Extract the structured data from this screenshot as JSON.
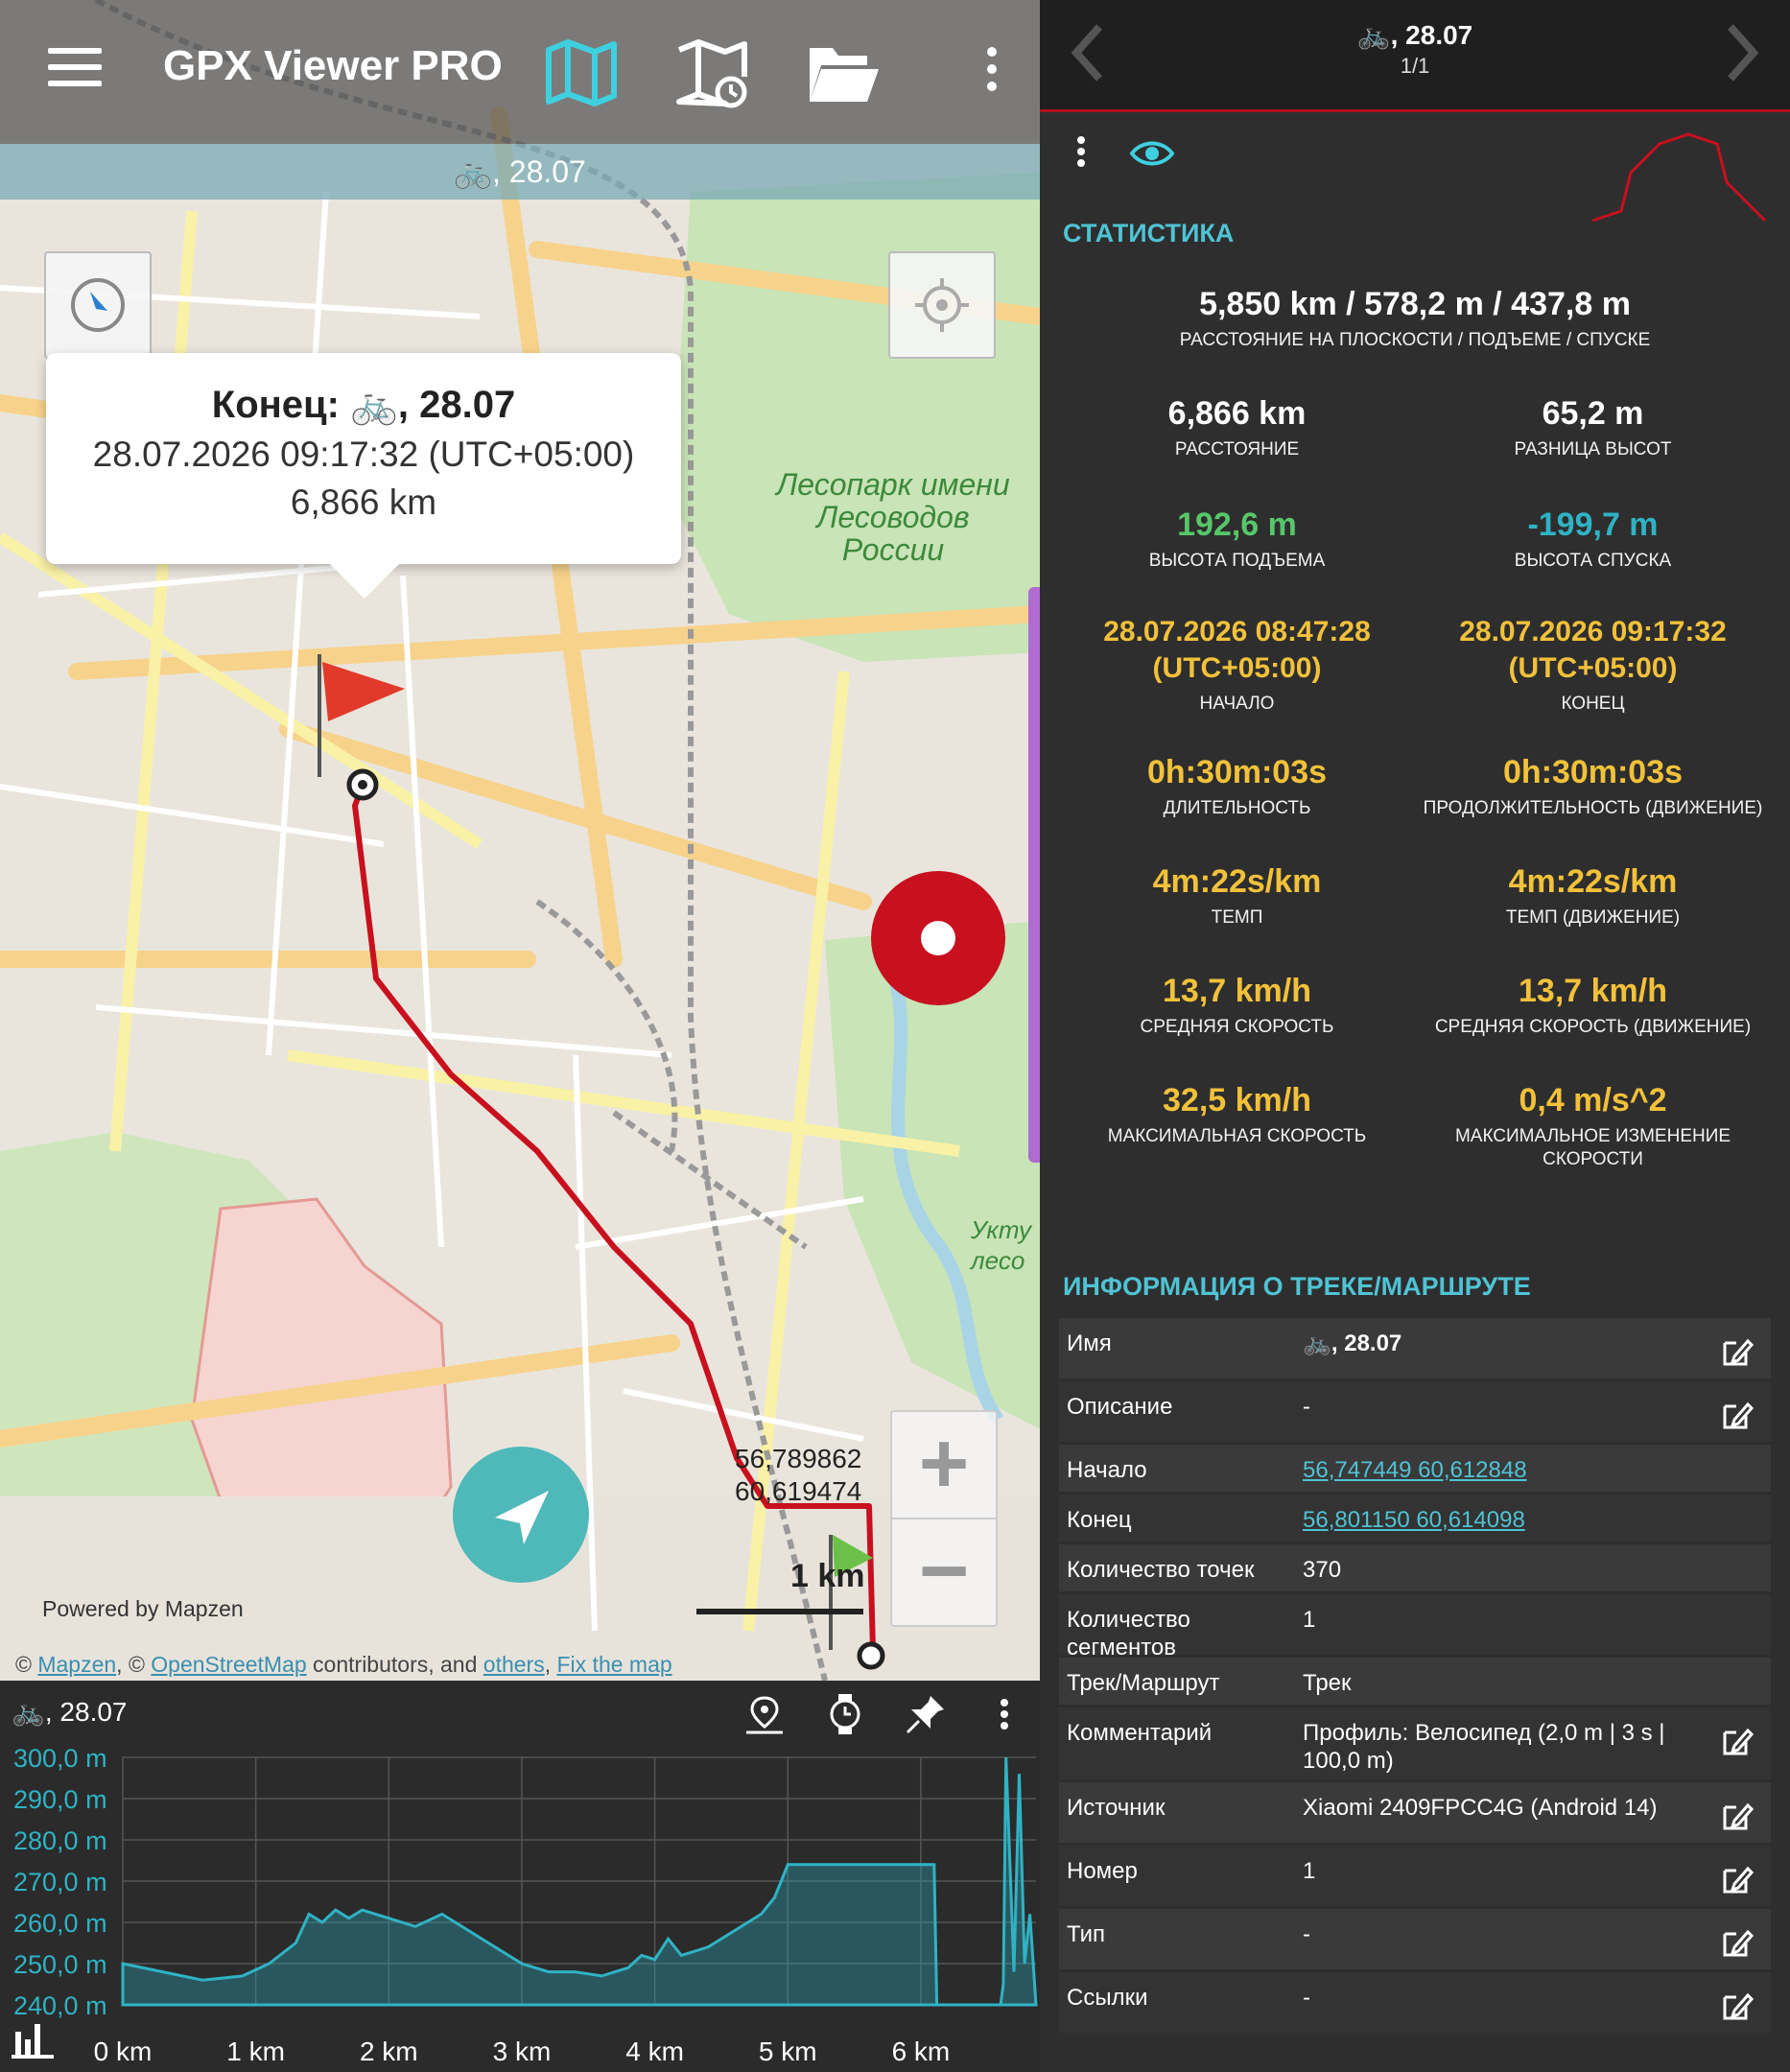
{
  "app": {
    "title": "GPX Viewer PRO",
    "track_label": "🚲, 28.07"
  },
  "map": {
    "popup": {
      "title": "Конец: 🚲, 28.07",
      "time": "28.07.2026 09:17:32 (UTC+05:00)",
      "distance": "6,866 km"
    },
    "park_label": [
      "Лесопарк имени",
      "Лесоводов",
      "России"
    ],
    "park_label2": [
      "Укту",
      "лесо"
    ],
    "coords": [
      "56,789862",
      "60,619474"
    ],
    "scale": "1 km",
    "powered_by": "Powered by Mapzen",
    "attribution": {
      "prefix": "© ",
      "mapzen": "Mapzen",
      "sep": ", © ",
      "osm": "OpenStreetMap",
      "mid": " contributors, and ",
      "others": "others",
      "comma": ", ",
      "fix": "Fix the map"
    },
    "zoom_in": "+",
    "zoom_out": "−"
  },
  "chart": {
    "title": "🚲, 28.07",
    "chart_data": {
      "type": "area",
      "ylabel_ticks": [
        "300,0 m",
        "290,0 m",
        "280,0 m",
        "270,0 m",
        "260,0 m",
        "250,0 m",
        "240,0 m"
      ],
      "xlabel_ticks": [
        "0 km",
        "1 km",
        "2 km",
        "3 km",
        "4 km",
        "5 km",
        "6 km"
      ],
      "ylim": [
        240,
        300
      ],
      "xlim": [
        0,
        6.866
      ],
      "x": [
        0,
        0.3,
        0.6,
        0.9,
        1.1,
        1.3,
        1.4,
        1.5,
        1.6,
        1.7,
        1.8,
        2.0,
        2.2,
        2.4,
        2.6,
        2.8,
        3.0,
        3.2,
        3.4,
        3.6,
        3.8,
        3.9,
        4.0,
        4.1,
        4.2,
        4.4,
        4.6,
        4.8,
        4.9,
        5.0,
        5.1,
        5.2,
        5.5,
        5.8,
        6.0,
        6.1,
        6.12,
        6.14,
        6.3,
        6.5,
        6.6,
        6.62,
        6.64,
        6.7,
        6.74,
        6.78,
        6.82,
        6.866
      ],
      "y": [
        250,
        248,
        246,
        247,
        250,
        255,
        262,
        260,
        263,
        261,
        263,
        261,
        259,
        262,
        258,
        254,
        250,
        248,
        248,
        247,
        249,
        252,
        251,
        256,
        252,
        254,
        258,
        262,
        266,
        274,
        274,
        274,
        274,
        274,
        274,
        274,
        240,
        240,
        240,
        240,
        240,
        245,
        300,
        248,
        296,
        250,
        262,
        240
      ]
    }
  },
  "panel": {
    "header_name": "🚲, 28.07",
    "header_page": "1/1",
    "stats_title": "СТАТИСТИКА",
    "summary": {
      "value": "5,850 km / 578,2 m / 437,8 m",
      "label": "РАССТОЯНИЕ НА ПЛОСКОСТИ / ПОДЪЕМЕ / СПУСКЕ"
    },
    "stats": [
      {
        "v": "6,866 km",
        "l": "РАССТОЯНИЕ",
        "c": "white"
      },
      {
        "v": "65,2 m",
        "l": "РАЗНИЦА ВЫСОТ",
        "c": "white"
      },
      {
        "v": "192,6 m",
        "l": "ВЫСОТА ПОДЪЕМА",
        "c": "green"
      },
      {
        "v": "-199,7 m",
        "l": "ВЫСОТА СПУСКА",
        "c": "teal"
      },
      {
        "v": "28.07.2026 08:47:28 (UTC+05:00)",
        "l": "НАЧАЛО",
        "c": "yellow"
      },
      {
        "v": "28.07.2026 09:17:32 (UTC+05:00)",
        "l": "КОНЕЦ",
        "c": "yellow"
      },
      {
        "v": "0h:30m:03s",
        "l": "ДЛИТЕЛЬНОСТЬ",
        "c": "yellow"
      },
      {
        "v": "0h:30m:03s",
        "l": "ПРОДОЛЖИТЕЛЬНОСТЬ (ДВИЖЕНИЕ)",
        "c": "yellow"
      },
      {
        "v": "4m:22s/km",
        "l": "ТЕМП",
        "c": "yellow"
      },
      {
        "v": "4m:22s/km",
        "l": "ТЕМП (ДВИЖЕНИЕ)",
        "c": "yellow"
      },
      {
        "v": "13,7 km/h",
        "l": "СРЕДНЯЯ СКОРОСТЬ",
        "c": "yellow"
      },
      {
        "v": "13,7 km/h",
        "l": "СРЕДНЯЯ СКОРОСТЬ (ДВИЖЕНИЕ)",
        "c": "yellow"
      },
      {
        "v": "32,5 km/h",
        "l": "МАКСИМАЛЬНАЯ СКОРОСТЬ",
        "c": "yellow"
      },
      {
        "v": "0,4 m/s^2",
        "l": "МАКСИМАЛЬНОЕ ИЗМЕНЕНИЕ СКОРОСТИ",
        "c": "yellow"
      }
    ],
    "info_title": "ИНФОРМАЦИЯ О ТРЕКЕ/МАРШРУТЕ",
    "info": [
      {
        "k": "Имя",
        "v": "🚲, 28.07",
        "bold": true,
        "edit": true
      },
      {
        "k": "Описание",
        "v": "-",
        "edit": true
      },
      {
        "k": "Начало",
        "v": "56,747449 60,612848",
        "link": true
      },
      {
        "k": "Конец",
        "v": "56,801150 60,614098",
        "link": true
      },
      {
        "k": "Количество точек",
        "v": "370"
      },
      {
        "k": "Количество сегментов",
        "v": "1"
      },
      {
        "k": "Трек/Маршрут",
        "v": "Трек"
      },
      {
        "k": "Комментарий",
        "v": "Профиль: Велосипед (2,0 m | 3 s | 100,0 m)",
        "edit": true
      },
      {
        "k": "Источник",
        "v": "Xiaomi 2409FPCC4G (Android 14)",
        "edit": true
      },
      {
        "k": "Номер",
        "v": "1",
        "edit": true
      },
      {
        "k": "Тип",
        "v": "-",
        "edit": true
      },
      {
        "k": "Ссылки",
        "v": "-",
        "edit": true
      }
    ]
  },
  "colors": {
    "accent": "#4fc3d4",
    "track": "#c8101e",
    "stat_yellow": "#f2c13a",
    "stat_green": "#57c76a"
  }
}
